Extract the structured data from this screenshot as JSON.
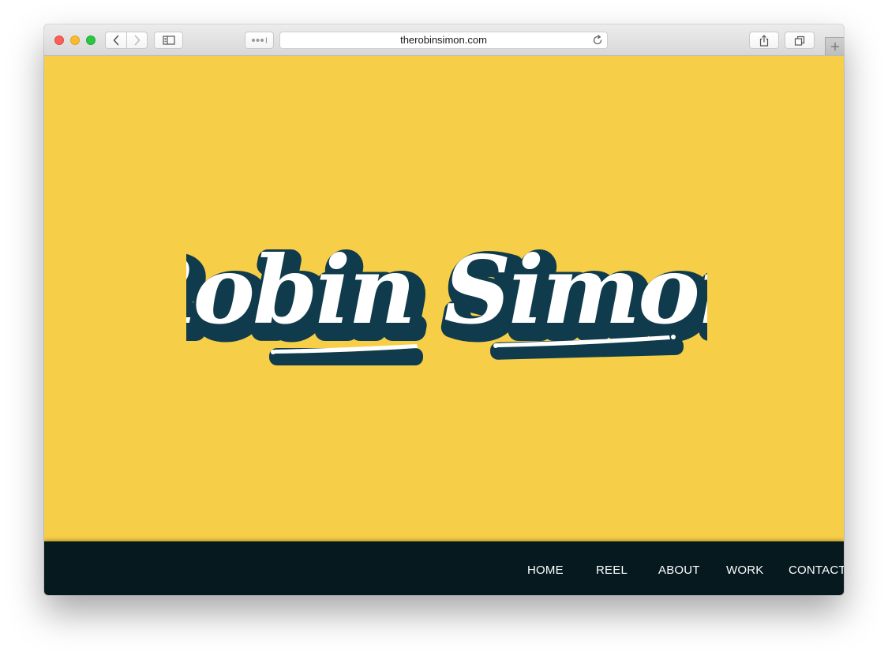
{
  "browser": {
    "url": "therobinsimon.com",
    "icons": {
      "back": "chevron-left-icon",
      "forward": "chevron-right-icon",
      "sidebar": "sidebar-icon",
      "reader": "ellipsis-icon",
      "reload": "reload-icon",
      "share": "share-icon",
      "tabs": "tabs-icon",
      "new_tab": "plus-icon"
    }
  },
  "hero": {
    "logo_text": "Robin Simon",
    "background_color": "#f6ce48",
    "logo_fill_color": "#ffffff",
    "logo_outline_color": "#0f3b4c"
  },
  "nav": {
    "background_color": "#05191f",
    "items": [
      {
        "label": "HOME"
      },
      {
        "label": "REEL"
      },
      {
        "label": "ABOUT"
      },
      {
        "label": "WORK"
      },
      {
        "label": "CONTACT"
      }
    ]
  }
}
